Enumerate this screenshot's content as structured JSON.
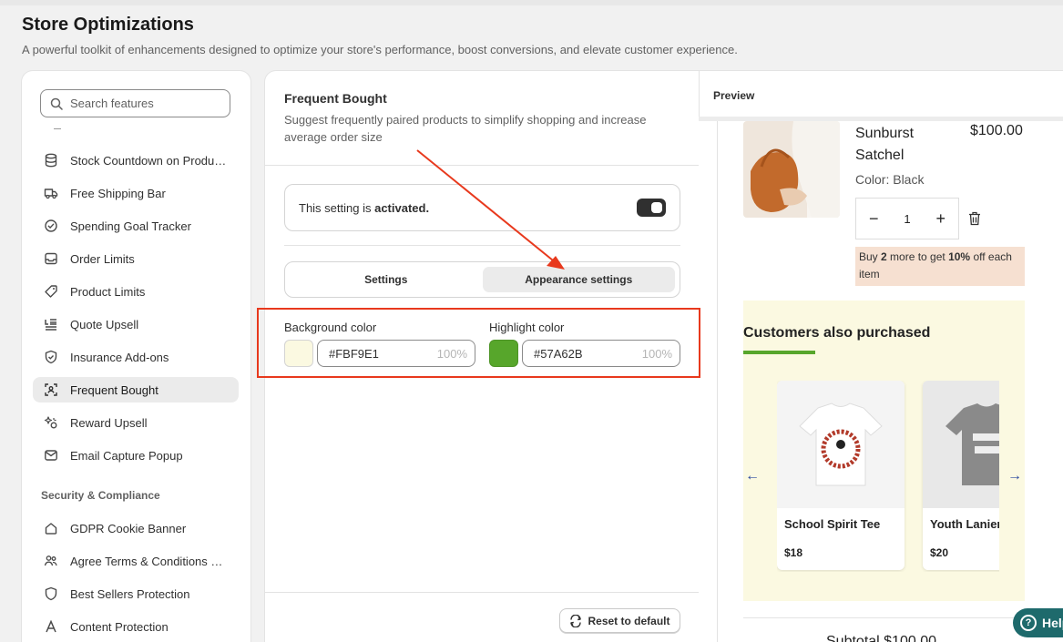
{
  "page": {
    "title": "Store Optimizations",
    "subtitle": "A powerful toolkit of enhancements designed to optimize your store's performance, boost conversions, and elevate customer experience."
  },
  "sidebar": {
    "search_placeholder": "Search features",
    "items": [
      {
        "label": "Stock Countdown on Produ…",
        "icon": "database-icon"
      },
      {
        "label": "Free Shipping Bar",
        "icon": "truck-icon"
      },
      {
        "label": "Spending Goal Tracker",
        "icon": "check-circle-icon"
      },
      {
        "label": "Order Limits",
        "icon": "inbox-icon"
      },
      {
        "label": "Product Limits",
        "icon": "tag-icon"
      },
      {
        "label": "Quote Upsell",
        "icon": "list-icon"
      },
      {
        "label": "Insurance Add-ons",
        "icon": "shield-check-icon"
      },
      {
        "label": "Frequent Bought",
        "icon": "scan-icon",
        "active": true
      },
      {
        "label": "Reward Upsell",
        "icon": "sparkle-icon"
      },
      {
        "label": "Email Capture Popup",
        "icon": "email-icon"
      }
    ],
    "section_security": "Security & Compliance",
    "security_items": [
      {
        "label": "GDPR Cookie Banner",
        "icon": "cookie-icon"
      },
      {
        "label": "Agree Terms & Conditions …",
        "icon": "people-icon"
      },
      {
        "label": "Best Sellers Protection",
        "icon": "shield-icon"
      },
      {
        "label": "Content Protection",
        "icon": "text-icon"
      }
    ]
  },
  "settings": {
    "title": "Frequent Bought",
    "description": "Suggest frequently paired products to simplify shopping and increase average order size",
    "activation_text_prefix": "This setting is ",
    "activation_text_bold": "activated.",
    "toggle_on": true,
    "tabs": [
      {
        "label": "Settings",
        "active": false
      },
      {
        "label": "Appearance settings",
        "active": true
      }
    ],
    "background_color": {
      "label": "Background color",
      "value": "#FBF9E1",
      "opacity": "100%",
      "swatch": "#FBF9E1"
    },
    "highlight_color": {
      "label": "Highlight color",
      "value": "#57A62B",
      "opacity": "100%",
      "swatch": "#57A62B"
    },
    "reset_label": "Reset to default"
  },
  "preview": {
    "label": "Preview",
    "product": {
      "name": "Sunburst Satchel",
      "price": "$100.00",
      "variant": "Color: Black",
      "quantity": "1",
      "minus": "−",
      "plus": "+"
    },
    "promo": {
      "pre": "Buy ",
      "qty": "2",
      "mid": " more to get ",
      "pct": "10%",
      "post": " off each item"
    },
    "upsell": {
      "title": "Customers also purchased",
      "prev_arrow": "←",
      "next_arrow": "→",
      "products": [
        {
          "name": "School Spirit Tee",
          "price": "$18"
        },
        {
          "name": "Youth Lanier",
          "price": "$20"
        }
      ]
    },
    "subtotal": "Subtotal $100.00"
  },
  "help": {
    "label": "Help"
  },
  "colors": {
    "accent_dark": "#303030",
    "annotation_red": "#E8391D",
    "highlight": "#57A62B",
    "upsell_bg": "#FBF9E1",
    "promo_bg": "#F6E0D1"
  }
}
